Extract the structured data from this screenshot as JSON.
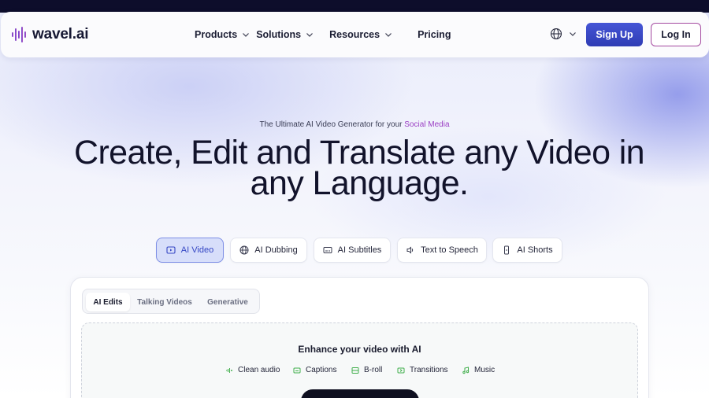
{
  "brand": {
    "name": "wavel.ai"
  },
  "nav": {
    "items": [
      {
        "label": "Products",
        "has_dropdown": true
      },
      {
        "label": "Solutions",
        "has_dropdown": true
      },
      {
        "label": "Resources",
        "has_dropdown": true
      },
      {
        "label": "Pricing",
        "has_dropdown": false
      }
    ],
    "language_icon": "globe-icon",
    "signup_label": "Sign Up",
    "login_label": "Log In"
  },
  "hero": {
    "tagline_prefix": "The Ultimate AI Video Generator for your",
    "tagline_accent": "Social Media",
    "title_line1": "Create, Edit and Translate any Video in",
    "title_line2": "any Language."
  },
  "product_tabs": [
    {
      "label": "AI Video",
      "icon": "play-box-icon",
      "active": true
    },
    {
      "label": "AI Dubbing",
      "icon": "globe-icon",
      "active": false
    },
    {
      "label": "AI Subtitles",
      "icon": "subtitles-icon",
      "active": false
    },
    {
      "label": "Text to Speech",
      "icon": "speaker-icon",
      "active": false
    },
    {
      "label": "AI Shorts",
      "icon": "phone-icon",
      "active": false
    }
  ],
  "editor": {
    "subtabs": [
      {
        "label": "AI Edits",
        "active": true
      },
      {
        "label": "Talking Videos",
        "active": false
      },
      {
        "label": "Generative",
        "active": false
      }
    ],
    "dropzone_title": "Enhance your video with AI",
    "features": [
      {
        "label": "Clean audio",
        "icon": "waveform-icon"
      },
      {
        "label": "Captions",
        "icon": "captions-icon"
      },
      {
        "label": "B-roll",
        "icon": "film-icon"
      },
      {
        "label": "Transitions",
        "icon": "transitions-icon"
      },
      {
        "label": "Music",
        "icon": "music-note-icon"
      }
    ]
  },
  "colors": {
    "accent": "#3547c4",
    "signup_bg": "#3a48c8",
    "login_border": "#a44aa0",
    "tagline_accent": "#9b3fc4",
    "feature_icon": "#3fae4a",
    "hero_text": "#12132b"
  }
}
